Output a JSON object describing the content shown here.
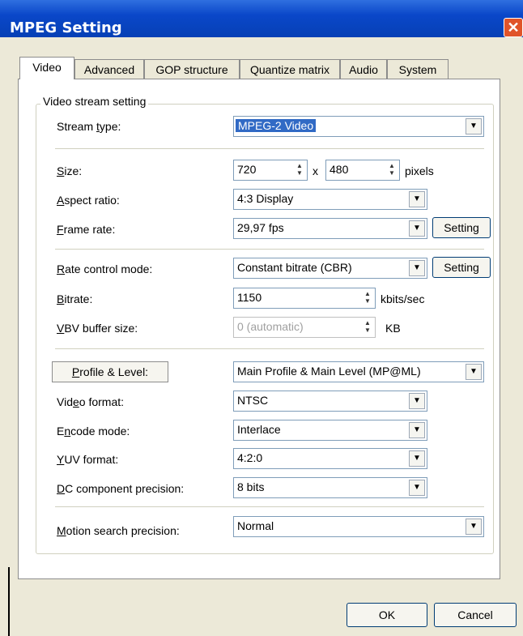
{
  "window": {
    "title": "MPEG Setting",
    "close_glyph": "✕"
  },
  "tabs": [
    "Video",
    "Advanced",
    "GOP structure",
    "Quantize matrix",
    "Audio",
    "System"
  ],
  "group": {
    "label": "Video stream setting"
  },
  "stream_type": {
    "label_pre": "Stream ",
    "label_ul": "t",
    "label_post": "ype:",
    "value": "MPEG-2 Video"
  },
  "size": {
    "label_ul": "S",
    "label_post": "ize:",
    "width": "720",
    "height": "480",
    "times": "x",
    "unit": "pixels"
  },
  "aspect": {
    "label_ul": "A",
    "label_post": "spect ratio:",
    "value": "4:3 Display"
  },
  "frame_rate": {
    "label_ul": "F",
    "label_post": "rame rate:",
    "value": "29,97 fps",
    "button": "Setting"
  },
  "rate_control": {
    "label_ul": "R",
    "label_post": "ate control mode:",
    "value": "Constant bitrate (CBR)",
    "button": "Setting"
  },
  "bitrate": {
    "label_ul": "B",
    "label_post": "itrate:",
    "value": "1150",
    "unit": "kbits/sec"
  },
  "vbv": {
    "label_ul": "V",
    "label_post": "BV buffer size:",
    "value": "0 (automatic)",
    "unit": "KB"
  },
  "profile": {
    "button_ul": "P",
    "button_post": "rofile & Level:",
    "value": "Main Profile & Main Level (MP@ML)"
  },
  "video_format": {
    "label_pre": "Vid",
    "label_ul": "e",
    "label_post": "o format:",
    "value": "NTSC"
  },
  "encode_mode": {
    "label_pre": "E",
    "label_ul": "n",
    "label_post": "code mode:",
    "value": "Interlace"
  },
  "yuv": {
    "label_ul": "Y",
    "label_post": "UV format:",
    "value": "4:2:0"
  },
  "dc": {
    "label_ul": "D",
    "label_post": "C component precision:",
    "value": "8 bits"
  },
  "motion": {
    "label_ul": "M",
    "label_post": "otion search precision:",
    "value": "Normal"
  },
  "footer": {
    "ok": "OK",
    "cancel": "Cancel"
  },
  "colors": {
    "titlebar": "#0a47c9",
    "selection": "#316ac5",
    "close": "#e0542a"
  }
}
